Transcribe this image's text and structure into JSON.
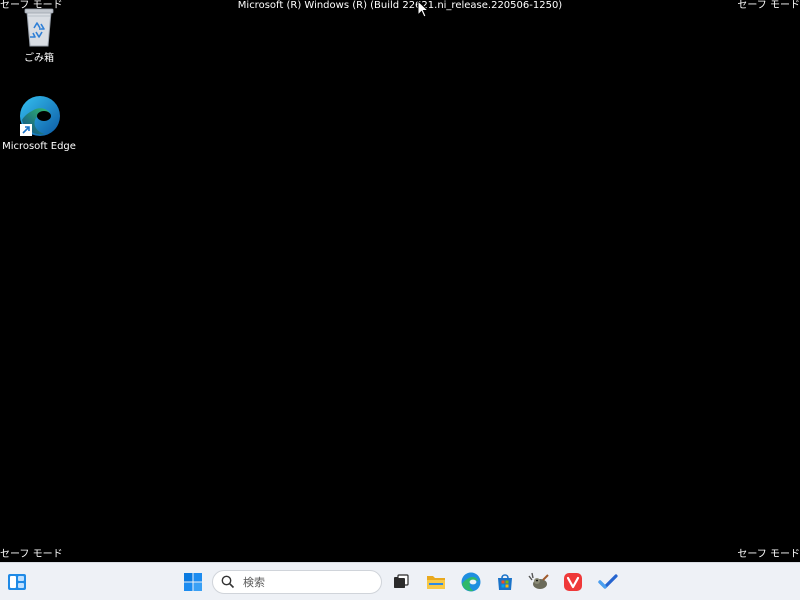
{
  "safe_mode": {
    "top_left": "セーフ モード",
    "top_right": "セーフ モード",
    "bottom_left": "セーフ モード",
    "bottom_right": "セーフ モード"
  },
  "build_info": "Microsoft (R) Windows (R) (Build 22621.ni_release.220506-1250)",
  "desktop_icons": [
    {
      "label": "ごみ箱",
      "icon": "recycle-bin-icon"
    },
    {
      "label": "Microsoft Edge",
      "icon": "edge-icon"
    }
  ],
  "taskbar": {
    "search_placeholder": "検索",
    "apps": [
      {
        "name": "widgets",
        "icon": "widgets-icon"
      },
      {
        "name": "start",
        "icon": "windows-logo-icon"
      },
      {
        "name": "task-view",
        "icon": "task-view-icon"
      },
      {
        "name": "file-explorer",
        "icon": "folder-icon"
      },
      {
        "name": "edge",
        "icon": "edge-icon"
      },
      {
        "name": "store",
        "icon": "store-icon"
      },
      {
        "name": "gimp",
        "icon": "gimp-icon"
      },
      {
        "name": "vivaldi",
        "icon": "vivaldi-icon"
      },
      {
        "name": "todo",
        "icon": "checkmark-icon"
      }
    ]
  },
  "colors": {
    "desktop_bg": "#000000",
    "taskbar_bg": "#eef1f6",
    "windows_blue": "#0078d4",
    "vivaldi_red": "#ef3939",
    "folder_yellow": "#f4c542"
  }
}
